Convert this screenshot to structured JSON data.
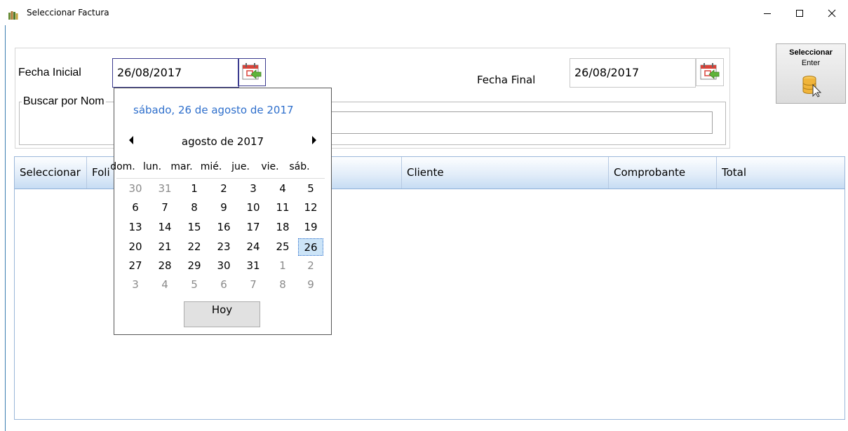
{
  "window": {
    "title": "Seleccionar Factura",
    "controls": {
      "minimize": "—",
      "maximize": "☐",
      "close": "✕"
    }
  },
  "filters": {
    "fecha_inicial_label": "Fecha Inicial",
    "fecha_inicial_value": "26/08/2017",
    "fecha_final_label": "Fecha Final",
    "fecha_final_value": "26/08/2017",
    "buscar_label": "Buscar por Nom",
    "buscar_value": ""
  },
  "select_button": {
    "title": "Seleccionar",
    "shortcut": "Enter",
    "icon": "database-cursor-icon"
  },
  "grid": {
    "columns": [
      "Seleccionar",
      "Foli",
      "Cliente",
      "Comprobante",
      "Total"
    ]
  },
  "calendar": {
    "today_long": "sábado, 26 de agosto de 2017",
    "month_label": "agosto de 2017",
    "day_headers": [
      "dom.",
      "lun.",
      "mar.",
      "mié.",
      "jue.",
      "vie.",
      "sáb."
    ],
    "weeks": [
      [
        "30",
        "31",
        "1",
        "2",
        "3",
        "4",
        "5"
      ],
      [
        "6",
        "7",
        "8",
        "9",
        "10",
        "11",
        "12"
      ],
      [
        "13",
        "14",
        "15",
        "16",
        "17",
        "18",
        "19"
      ],
      [
        "20",
        "21",
        "22",
        "23",
        "24",
        "25",
        "26"
      ],
      [
        "27",
        "28",
        "29",
        "30",
        "31",
        "1",
        "2"
      ],
      [
        "3",
        "4",
        "5",
        "6",
        "7",
        "8",
        "9"
      ]
    ],
    "selected_day": "26",
    "today_button": "Hoy"
  },
  "colors": {
    "accent": "#2e6fcc",
    "grid_header": "#dbe8f7",
    "selected_day_bg": "#cce4f7"
  }
}
